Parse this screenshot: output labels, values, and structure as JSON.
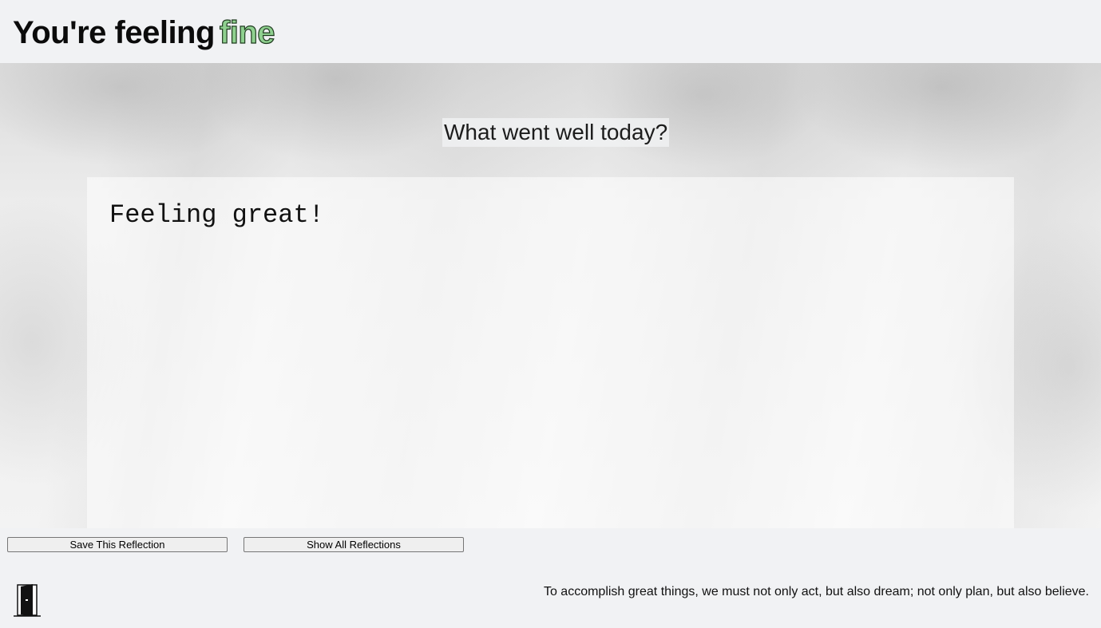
{
  "header": {
    "title_prefix": "You're feeling",
    "mood_word": "fine",
    "mood_color": "#8fd08f"
  },
  "prompt": {
    "question": "What went well today?"
  },
  "reflection": {
    "text": "Feeling great!"
  },
  "actions": {
    "save_label": "Save This Reflection",
    "show_label": "Show All Reflections"
  },
  "footer": {
    "exit_icon": "door-icon",
    "quote": "To accomplish great things, we must not only act, but also dream; not only plan, but also believe."
  }
}
